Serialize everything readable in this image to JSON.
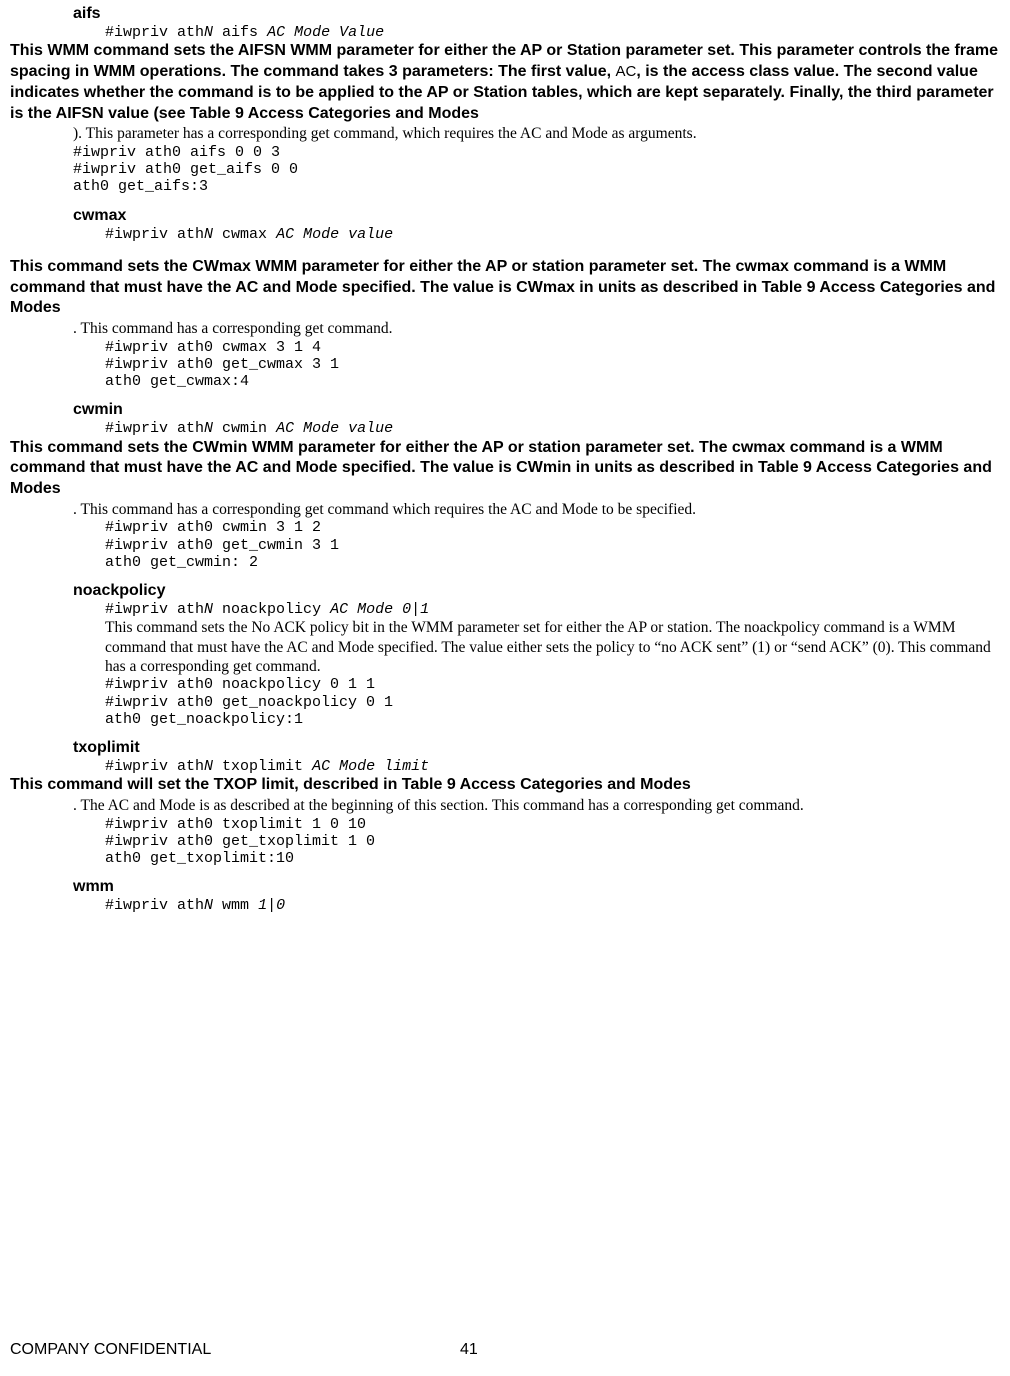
{
  "aifs": {
    "name": "aifs",
    "syntax_pre": "#iwpriv ath",
    "syntax_n": "N",
    "syntax_mid": " aifs ",
    "syntax_args": "AC Mode Value",
    "desc_a": "This WMM command sets the AIFSN WMM parameter for either the AP or Station parameter set. This parameter controls the frame spacing in WMM operations. The command takes 3 parameters: The first value, ",
    "desc_ac": "AC",
    "desc_b": ", is the access class value. The second value indicates whether the command is to be applied to the AP or Station tables, which are kept separately. Finally, the third parameter is the AIFSN value (see Table 9 Access Categories and Modes",
    "post": "). This parameter has a corresponding get command, which requires the AC and Mode as arguments.",
    "ex": "#iwpriv ath0 aifs 0 0 3\n#iwpriv ath0 get_aifs 0 0\nath0 get_aifs:3"
  },
  "cwmax": {
    "name": "cwmax",
    "syntax_pre": "#iwpriv ath",
    "syntax_n": "N",
    "syntax_mid": " cwmax ",
    "syntax_args": "AC Mode value",
    "desc": "This command sets the CWmax WMM parameter for either the AP or station parameter set. The cwmax command is a WMM command that must have the AC and Mode specified. The value is CWmax in units as described in Table 9 Access Categories and Modes",
    "post": ". This command has a corresponding get command.",
    "ex": "#iwpriv ath0 cwmax 3 1 4\n#iwpriv ath0 get_cwmax 3 1\nath0 get_cwmax:4"
  },
  "cwmin": {
    "name": "cwmin",
    "syntax_pre": "#iwpriv ath",
    "syntax_n": "N",
    "syntax_mid": " cwmin ",
    "syntax_args": "AC Mode value",
    "desc": "This command sets the CWmin WMM parameter for either the AP or station parameter set. The cwmax command is a WMM command that must have the AC and Mode specified. The value is CWmin in units as described in Table 9 Access Categories and Modes",
    "post": ". This command has a corresponding get command which requires the AC and Mode to be specified.",
    "ex": "#iwpriv ath0 cwmin 3 1 2\n#iwpriv ath0 get_cwmin 3 1\nath0 get_cwmin: 2"
  },
  "noack": {
    "name": "noackpolicy",
    "syntax_pre": "#iwpriv ath",
    "syntax_n": "N",
    "syntax_mid": " noackpolicy ",
    "syntax_args": "AC Mode 0|1",
    "desc": "This command sets the No ACK policy bit in the WMM parameter set for either the AP or station. The noackpolicy command is a WMM command that must have the AC and Mode specified. The value either sets the policy to “no ACK sent” (1) or “send ACK” (0). This command has a corresponding get command.",
    "ex": "#iwpriv ath0 noackpolicy 0 1 1\n#iwpriv ath0 get_noackpolicy 0 1\nath0 get_noackpolicy:1"
  },
  "txop": {
    "name": "txoplimit",
    "syntax_pre": "#iwpriv ath",
    "syntax_n": "N",
    "syntax_mid": " txoplimit ",
    "syntax_args": "AC Mode limit",
    "desc": "This command will set the TXOP limit, described in Table 9 Access Categories and Modes",
    "post": ". The AC and Mode is as described at the beginning of this section. This command has a corresponding get command.",
    "ex": "#iwpriv ath0 txoplimit 1 0 10\n#iwpriv ath0 get_txoplimit 1 0\nath0 get_txoplimit:10"
  },
  "wmm": {
    "name": "wmm",
    "syntax_pre": "#iwpriv ath",
    "syntax_n": "N",
    "syntax_mid": " wmm ",
    "syntax_args": "1|0"
  },
  "footer": {
    "left": "COMPANY CONFIDENTIAL",
    "page": "41"
  }
}
